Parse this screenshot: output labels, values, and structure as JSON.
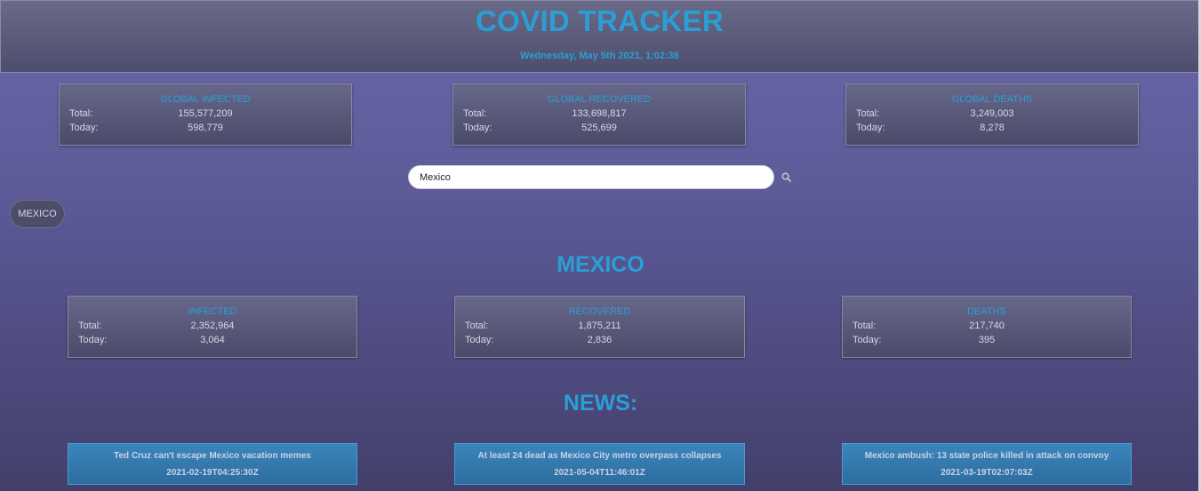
{
  "header": {
    "title": "COVID TRACKER",
    "datetime": "Wednesday, May 5th 2021, 1:02:36"
  },
  "global": [
    {
      "title": "GLOBAL INFECTED",
      "total_label": "Total:",
      "total": "155,577,209",
      "today_label": "Today:",
      "today": "598,779"
    },
    {
      "title": "GLOBAL RECOVERED",
      "total_label": "Total:",
      "total": "133,698,817",
      "today_label": "Today:",
      "today": "525,699"
    },
    {
      "title": "GLOBAL DEATHS",
      "total_label": "Total:",
      "total": "3,249,003",
      "today_label": "Today:",
      "today": "8,278"
    }
  ],
  "search": {
    "value": "Mexico",
    "icon": "search-icon"
  },
  "chip": {
    "label": "MEXICO"
  },
  "country": {
    "name": "MEXICO",
    "stats": [
      {
        "title": "INFECTED",
        "total_label": "Total:",
        "total": "2,352,964",
        "today_label": "Today:",
        "today": "3,064"
      },
      {
        "title": "RECOVERED",
        "total_label": "Total:",
        "total": "1,875,211",
        "today_label": "Today:",
        "today": "2,836"
      },
      {
        "title": "DEATHS",
        "total_label": "Total:",
        "total": "217,740",
        "today_label": "Today:",
        "today": "395"
      }
    ]
  },
  "news": {
    "title": "NEWS:",
    "items": [
      {
        "headline": "Ted Cruz can't escape Mexico vacation memes",
        "date": "2021-02-19T04:25:30Z"
      },
      {
        "headline": "At least 24 dead as Mexico City metro overpass collapses",
        "date": "2021-05-04T11:46:01Z"
      },
      {
        "headline": "Mexico ambush: 13 state police killed in attack on convoy",
        "date": "2021-03-19T02:07:03Z"
      }
    ]
  },
  "colors": {
    "accent": "#2a9fd6",
    "news_card": "#3a86bd",
    "background": "#5a5894"
  }
}
